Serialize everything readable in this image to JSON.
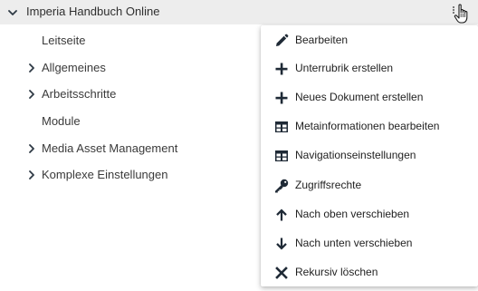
{
  "tree": {
    "root": {
      "label": "Imperia Handbuch Online",
      "icon": "chevron-down-icon"
    },
    "items": [
      {
        "label": "Leitseite",
        "expandable": false
      },
      {
        "label": "Allgemeines",
        "expandable": true
      },
      {
        "label": "Arbeitsschritte",
        "expandable": true
      },
      {
        "label": "Module",
        "expandable": false
      },
      {
        "label": "Media Asset Management",
        "expandable": true
      },
      {
        "label": "Komplexe Einstellungen",
        "expandable": true
      }
    ]
  },
  "context_menu": {
    "items": [
      {
        "label": "Bearbeiten",
        "icon": "pencil-icon"
      },
      {
        "label": "Unterrubrik erstellen",
        "icon": "plus-icon"
      },
      {
        "label": "Neues Dokument erstellen",
        "icon": "plus-icon"
      },
      {
        "label": "Metainformationen bearbeiten",
        "icon": "table-icon"
      },
      {
        "label": "Navigationseinstellungen",
        "icon": "table-icon"
      },
      {
        "label": "Zugriffsrechte",
        "icon": "key-icon"
      },
      {
        "label": "Nach oben verschieben",
        "icon": "arrow-up-icon"
      },
      {
        "label": "Nach unten verschieben",
        "icon": "arrow-down-icon"
      },
      {
        "label": "Rekursiv löschen",
        "icon": "close-x-icon"
      }
    ]
  },
  "colors": {
    "root_background": "#ededed",
    "menu_background": "#ffffff",
    "text": "#3a3a3a",
    "icon": "#1f2a36"
  }
}
